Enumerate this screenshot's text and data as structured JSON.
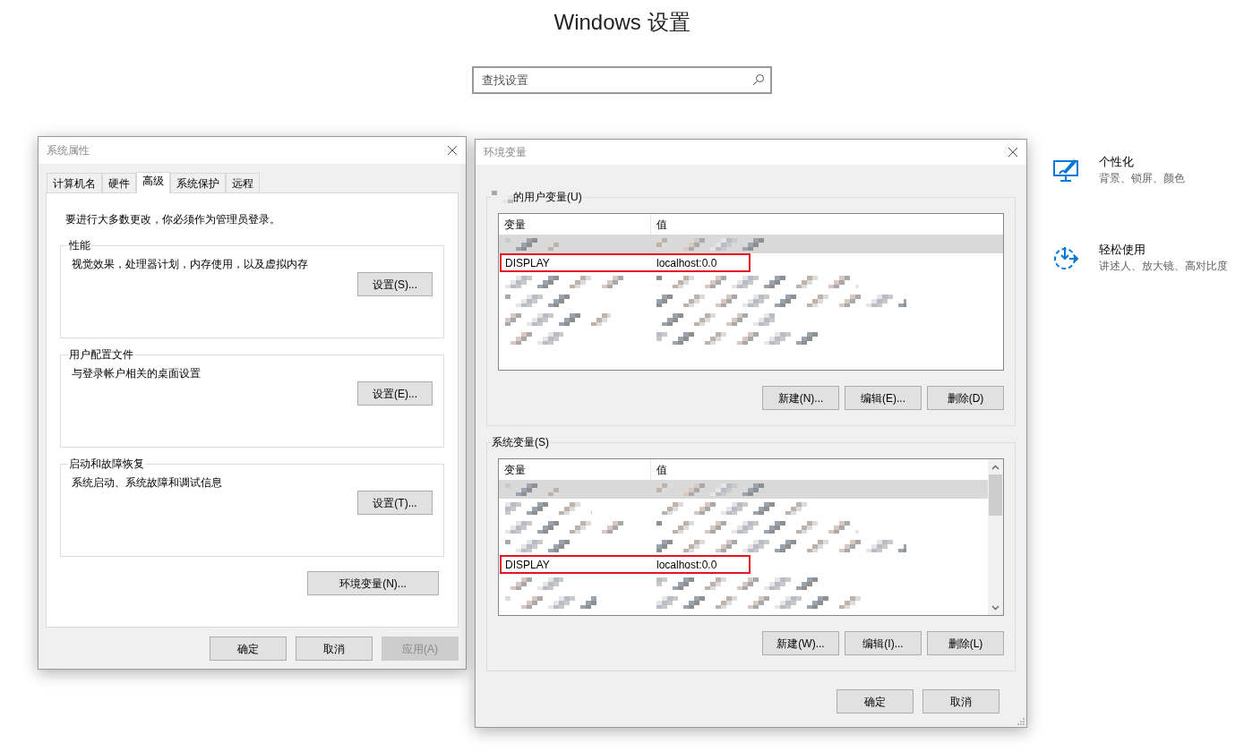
{
  "settings_page": {
    "title": "Windows 设置",
    "search": {
      "placeholder": "查找设置"
    },
    "categories": [
      {
        "kind": "personalization",
        "title": "个性化",
        "subtitle": "背景、锁屏、颜色"
      },
      {
        "kind": "ease_of_access",
        "title": "轻松使用",
        "subtitle": "讲述人、放大镜、高对比度"
      }
    ]
  },
  "system_properties": {
    "title": "系统属性",
    "tabs": [
      {
        "label": "计算机名",
        "selected": false
      },
      {
        "label": "硬件",
        "selected": false
      },
      {
        "label": "高级",
        "selected": true
      },
      {
        "label": "系统保护",
        "selected": false
      },
      {
        "label": "远程",
        "selected": false
      }
    ],
    "notice": "要进行大多数更改，你必须作为管理员登录。",
    "groups": [
      {
        "title": "性能",
        "description": "视觉效果，处理器计划，内存使用，以及虚拟内存",
        "button": "设置(S)..."
      },
      {
        "title": "用户配置文件",
        "description": "与登录帐户相关的桌面设置",
        "button": "设置(E)..."
      },
      {
        "title": "启动和故障恢复",
        "description": "系统启动、系统故障和调试信息",
        "button": "设置(T)..."
      }
    ],
    "env_button": "环境变量(N)...",
    "buttons": [
      {
        "label": "确定",
        "disabled": false
      },
      {
        "label": "取消",
        "disabled": false
      },
      {
        "label": "应用(A)",
        "disabled": true
      }
    ]
  },
  "environment_variables": {
    "title": "环境变量",
    "user_variables": {
      "title": "的用户变量(U)",
      "title_redacted": true,
      "columns": [
        "变量",
        "值"
      ],
      "scrollbar": false,
      "rows": [
        {
          "kind": "redacted",
          "selected": true
        },
        {
          "kind": "entry",
          "name": "DISPLAY",
          "value": "localhost:0.0",
          "selected": false,
          "highlighted": true
        },
        {
          "kind": "redacted",
          "selected": false
        },
        {
          "kind": "redacted",
          "selected": false
        },
        {
          "kind": "redacted",
          "selected": false
        },
        {
          "kind": "redacted",
          "selected": false
        }
      ],
      "buttons": [
        "新建(N)...",
        "编辑(E)...",
        "删除(D)"
      ]
    },
    "system_variables": {
      "title": "系统变量(S)",
      "title_redacted": false,
      "columns": [
        "变量",
        "值"
      ],
      "scrollbar": true,
      "rows": [
        {
          "kind": "redacted",
          "selected": true
        },
        {
          "kind": "redacted",
          "selected": false
        },
        {
          "kind": "redacted",
          "selected": false
        },
        {
          "kind": "redacted",
          "selected": false
        },
        {
          "kind": "entry",
          "name": "DISPLAY",
          "value": "localhost:0.0",
          "selected": false,
          "highlighted": true
        },
        {
          "kind": "redacted",
          "selected": false
        },
        {
          "kind": "redacted",
          "selected": false
        }
      ],
      "buttons": [
        "新建(W)...",
        "编辑(I)...",
        "删除(L)"
      ]
    },
    "buttons": [
      "确定",
      "取消"
    ]
  }
}
